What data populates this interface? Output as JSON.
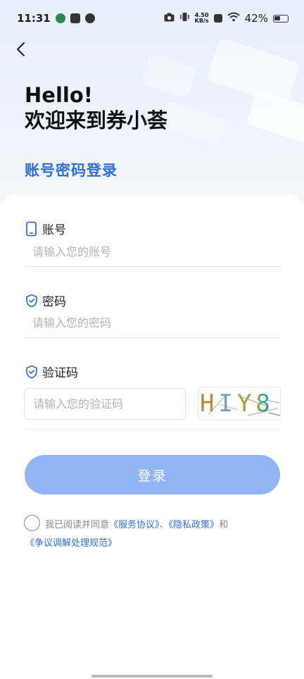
{
  "status_bar": {
    "time": "11:31",
    "net_speed_value": "4.50",
    "net_speed_unit": "KB/s",
    "battery": "42%"
  },
  "header": {
    "greeting_line1": "Hello!",
    "greeting_line2": "欢迎来到券小荟",
    "login_mode": "账号密码登录"
  },
  "form": {
    "account": {
      "label": "账号",
      "placeholder": "请输入您的账号",
      "value": ""
    },
    "password": {
      "label": "密码",
      "placeholder": "请输入您的密码",
      "value": ""
    },
    "code": {
      "label": "验证码",
      "placeholder": "请输入您的验证码",
      "value": "",
      "captcha": "HIY8"
    }
  },
  "login_button": "登录",
  "agreement": {
    "prefix": "我已阅读并同意",
    "service": "《服务协议》",
    "sep": "、",
    "privacy": "《隐私政策》",
    "and": "和",
    "dispute": "《争议调解处理规范》"
  },
  "colors": {
    "accent": "#2f6fd8",
    "button": "#93b4f4"
  }
}
